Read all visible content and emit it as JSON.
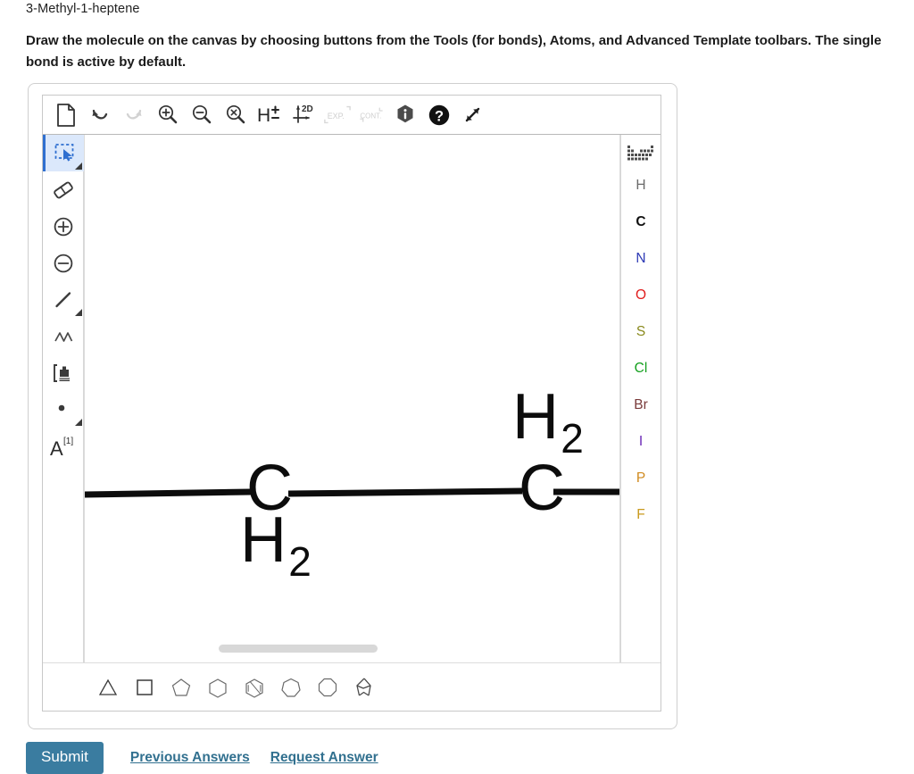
{
  "question": {
    "compound_name": "3-Methyl-1-heptene",
    "instruction": "Draw the molecule on the canvas by choosing buttons from the Tools (for bonds), Atoms, and Advanced Template toolbars. The single bond is active by default."
  },
  "top_toolbar": {
    "buttons": [
      {
        "name": "new-document-icon",
        "label": "New",
        "enabled": true
      },
      {
        "name": "undo-icon",
        "label": "Undo",
        "enabled": true
      },
      {
        "name": "redo-icon",
        "label": "Redo",
        "enabled": false
      },
      {
        "name": "zoom-in-icon",
        "label": "Zoom In",
        "enabled": true
      },
      {
        "name": "zoom-out-icon",
        "label": "Zoom Out",
        "enabled": true
      },
      {
        "name": "zoom-reset-icon",
        "label": "Reset Zoom",
        "enabled": true
      },
      {
        "name": "hydrogen-toggle-icon",
        "label": "H±",
        "enabled": true
      },
      {
        "name": "clean-2d-icon",
        "label": "2D",
        "enabled": true
      },
      {
        "name": "expand-groups-icon",
        "label": "EXP.",
        "enabled": false
      },
      {
        "name": "contract-groups-icon",
        "label": "CONT.",
        "enabled": false
      },
      {
        "name": "info-icon",
        "label": "Info",
        "enabled": true
      },
      {
        "name": "help-icon",
        "label": "Help",
        "enabled": true
      },
      {
        "name": "fullscreen-icon",
        "label": "Fullscreen",
        "enabled": true
      }
    ]
  },
  "tools_rail": {
    "items": [
      {
        "name": "tool-select",
        "label": "Select",
        "active": true,
        "has_submenu": true
      },
      {
        "name": "tool-eraser",
        "label": "Eraser",
        "active": false,
        "has_submenu": false
      },
      {
        "name": "tool-increase-charge",
        "label": "Increase Charge",
        "active": false,
        "has_submenu": false
      },
      {
        "name": "tool-decrease-charge",
        "label": "Decrease Charge",
        "active": false,
        "has_submenu": false
      },
      {
        "name": "tool-single-bond",
        "label": "Single Bond",
        "active": false,
        "has_submenu": true
      },
      {
        "name": "tool-chain",
        "label": "Chain",
        "active": false,
        "has_submenu": false
      },
      {
        "name": "tool-bracket",
        "label": "Bracket",
        "active": false,
        "has_submenu": false
      },
      {
        "name": "tool-radical",
        "label": "Radical",
        "active": false,
        "has_submenu": true
      },
      {
        "name": "tool-atom-label",
        "label": "A",
        "superscript": "[1]",
        "active": false,
        "has_submenu": false
      }
    ]
  },
  "atoms_rail": {
    "periodic_table_label": "Periodic Table",
    "items": [
      {
        "symbol": "H",
        "color": "#6b6b6b"
      },
      {
        "symbol": "C",
        "color": "#111111"
      },
      {
        "symbol": "N",
        "color": "#2d39b5"
      },
      {
        "symbol": "O",
        "color": "#e01b1b"
      },
      {
        "symbol": "S",
        "color": "#8a8a1e"
      },
      {
        "symbol": "Cl",
        "color": "#14a01e"
      },
      {
        "symbol": "Br",
        "color": "#7a3b3b"
      },
      {
        "symbol": "I",
        "color": "#6a28b5"
      },
      {
        "symbol": "P",
        "color": "#d08a1e"
      },
      {
        "symbol": "F",
        "color": "#c99a1e"
      }
    ]
  },
  "templates_toolbar": {
    "items": [
      {
        "name": "template-cyclopropane",
        "label": "Cyclopropane",
        "sides": 3
      },
      {
        "name": "template-cyclobutane",
        "label": "Cyclobutane",
        "sides": 4
      },
      {
        "name": "template-cyclopentane",
        "label": "Cyclopentane",
        "sides": 5
      },
      {
        "name": "template-cyclohexane",
        "label": "Cyclohexane",
        "sides": 6
      },
      {
        "name": "template-benzene",
        "label": "Benzene",
        "sides": 6
      },
      {
        "name": "template-cycloheptane",
        "label": "Cycloheptane",
        "sides": 7
      },
      {
        "name": "template-cyclooctane",
        "label": "Cyclooctane",
        "sides": 8
      },
      {
        "name": "template-norbornane",
        "label": "Norbornane",
        "sides": 0
      }
    ]
  },
  "canvas": {
    "molecule_labels": [
      {
        "carbon": "C",
        "hydrogen": "H",
        "subscript": "2",
        "position": "below"
      },
      {
        "carbon": "C",
        "hydrogen": "H",
        "subscript": "2",
        "position": "above"
      }
    ],
    "scrollbar_visible": true
  },
  "footer": {
    "submit_label": "Submit",
    "previous_answers_label": "Previous Answers",
    "request_answer_label": "Request Answer",
    "accent_color": "#3a7ca0",
    "link_color": "#31708f"
  }
}
